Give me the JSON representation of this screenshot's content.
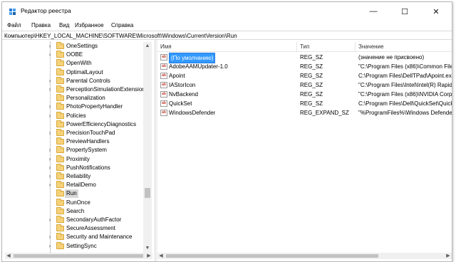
{
  "window": {
    "title": "Редактор реестра",
    "controls": {
      "minimize": "—",
      "maximize": "☐",
      "close": "✕"
    }
  },
  "menu": [
    {
      "label": "Файл"
    },
    {
      "label": "Правка"
    },
    {
      "label": "Вид"
    },
    {
      "label": "Избранное"
    },
    {
      "label": "Справка"
    }
  ],
  "address": "Компьютер\\HKEY_LOCAL_MACHINE\\SOFTWARE\\Microsoft\\Windows\\CurrentVersion\\Run",
  "tree": {
    "items": [
      {
        "label": "OneSettings",
        "expandable": true
      },
      {
        "label": "OOBE",
        "expandable": true
      },
      {
        "label": "OpenWith",
        "expandable": false
      },
      {
        "label": "OptimalLayout",
        "expandable": false
      },
      {
        "label": "Parental Controls",
        "expandable": true
      },
      {
        "label": "PerceptionSimulationExtension",
        "expandable": true
      },
      {
        "label": "Personalization",
        "expandable": false
      },
      {
        "label": "PhotoPropertyHandler",
        "expandable": true
      },
      {
        "label": "Policies",
        "expandable": true
      },
      {
        "label": "PowerEfficiencyDiagnostics",
        "expandable": false
      },
      {
        "label": "PrecisionTouchPad",
        "expandable": true
      },
      {
        "label": "PreviewHandlers",
        "expandable": false
      },
      {
        "label": "PropertySystem",
        "expandable": true
      },
      {
        "label": "Proximity",
        "expandable": true
      },
      {
        "label": "PushNotifications",
        "expandable": true
      },
      {
        "label": "Reliability",
        "expandable": true
      },
      {
        "label": "RetailDemo",
        "expandable": true
      },
      {
        "label": "Run",
        "expandable": false,
        "selected": true
      },
      {
        "label": "RunOnce",
        "expandable": false
      },
      {
        "label": "Search",
        "expandable": false
      },
      {
        "label": "SecondaryAuthFactor",
        "expandable": true
      },
      {
        "label": "SecureAssessment",
        "expandable": false
      },
      {
        "label": "Security and Maintenance",
        "expandable": true
      },
      {
        "label": "SettingSync",
        "expandable": true
      }
    ]
  },
  "list": {
    "columns": [
      "Имя",
      "Тип",
      "Значение"
    ],
    "rows": [
      {
        "name": "(По умолчанию)",
        "type": "REG_SZ",
        "value": "(значение не присвоено)",
        "selected": true
      },
      {
        "name": "AdobeAAMUpdater-1.0",
        "type": "REG_SZ",
        "value": "\"C:\\Program Files (x86)\\Common File"
      },
      {
        "name": "Apoint",
        "type": "REG_SZ",
        "value": "C:\\Program Files\\DellTPad\\Apoint.exe"
      },
      {
        "name": "IAStorIcon",
        "type": "REG_SZ",
        "value": "\"C:\\Program Files\\Intel\\Intel(R) Rapid"
      },
      {
        "name": "NvBackend",
        "type": "REG_SZ",
        "value": "\"C:\\Program Files (x86)\\NVIDIA Corpc"
      },
      {
        "name": "QuickSet",
        "type": "REG_SZ",
        "value": "C:\\Program Files\\Dell\\QuickSet\\Quick"
      },
      {
        "name": "WindowsDefender",
        "type": "REG_EXPAND_SZ",
        "value": "\"%ProgramFiles%\\Windows Defender"
      }
    ],
    "value_icon_text": "ab"
  },
  "scroll": {
    "up": "▲",
    "down": "▼",
    "left": "◀",
    "right": "▶"
  }
}
